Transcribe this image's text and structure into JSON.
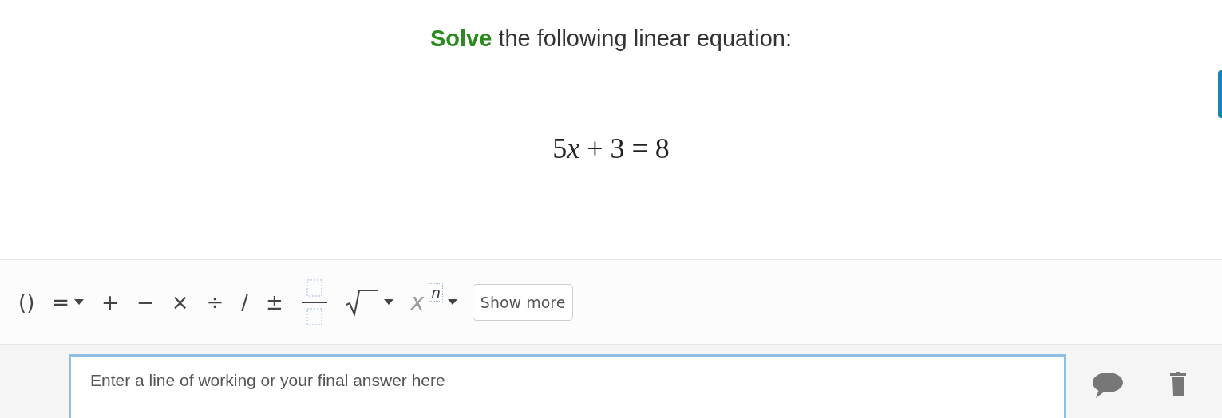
{
  "question": {
    "prompt": "**Solve** the following linear equation:",
    "equation": [
      {
        "kind": "number",
        "text": "5"
      },
      {
        "kind": "variable",
        "text": "x"
      },
      {
        "kind": "operator",
        "text": "+"
      },
      {
        "kind": "number",
        "text": "3"
      },
      {
        "kind": "operator",
        "text": "="
      },
      {
        "kind": "number",
        "text": "8"
      }
    ]
  },
  "toolbar": [
    {
      "kind": "symbol",
      "label": "()"
    },
    {
      "kind": "dropdown",
      "label": "="
    },
    {
      "kind": "symbol",
      "label": "+"
    },
    {
      "kind": "symbol",
      "label": "−"
    },
    {
      "kind": "symbol",
      "label": "×"
    },
    {
      "kind": "symbol",
      "label": "÷"
    },
    {
      "kind": "symbol",
      "label": "/"
    },
    {
      "kind": "symbol",
      "label": "±"
    },
    {
      "kind": "fraction"
    },
    {
      "kind": "sqrt"
    },
    {
      "kind": "power",
      "label": "x",
      "exponent": "n"
    },
    {
      "kind": "button",
      "label": "Show more"
    }
  ],
  "answer": {
    "placeholder": "Enter a line of working or your final answer here"
  }
}
